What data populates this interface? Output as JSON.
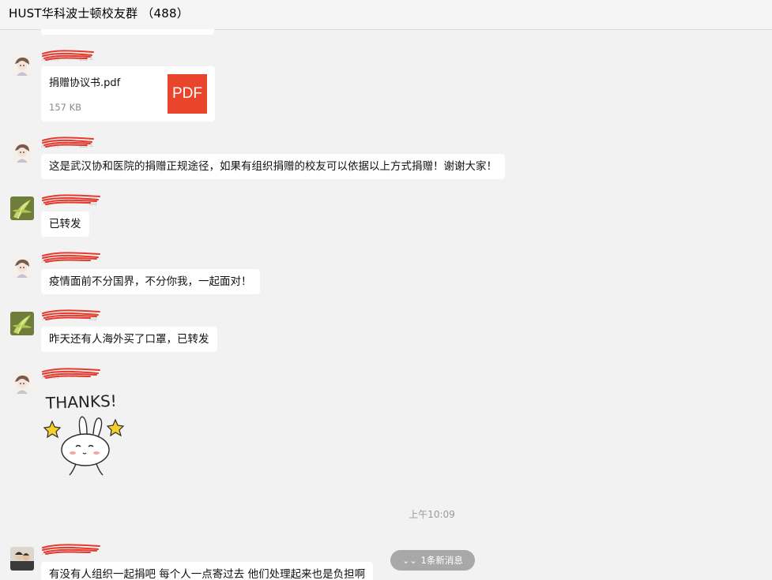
{
  "window": {
    "title": "HUST华科波士顿校友群 （488）"
  },
  "messages": [
    {
      "kind": "file",
      "sender": "周期一一圆1",
      "file": {
        "name": "捐赠协议书.pdf",
        "size": "157 KB",
        "icon_label": "PDF",
        "icon_color": "#e8452c"
      }
    },
    {
      "kind": "text",
      "sender": "周期一一圆1",
      "text": "这是武汉协和医院的捐赠正规途径，如果有组织捐赠的校友可以依据以上方式捐赠！谢谢大家！"
    },
    {
      "kind": "text",
      "sender": "刘一一一一圆",
      "text": "已转发"
    },
    {
      "kind": "text",
      "sender": "周一一一一",
      "text": "疫情面前不分国界，不分你我，一起面对！"
    },
    {
      "kind": "text",
      "sender": "刘一一一一圆",
      "text": "昨天还有人海外买了口罩，已转发"
    },
    {
      "kind": "sticker",
      "sender": "周期一一一",
      "sticker": {
        "caption": "THANKS!"
      }
    },
    {
      "kind": "text",
      "sender": "刘一一一一",
      "text": "有没有人组织一起捐吧  每个人一点寄过去  他们处理起来也是负担啊"
    }
  ],
  "timestamp": "上午10:09",
  "new_messages": {
    "label": "1条新消息",
    "icon": "double-chevron-down-icon"
  },
  "colors": {
    "background": "#f2f2f2",
    "bubble": "#ffffff",
    "redaction": "#e63a2e",
    "pill": "#a8a8a8"
  }
}
